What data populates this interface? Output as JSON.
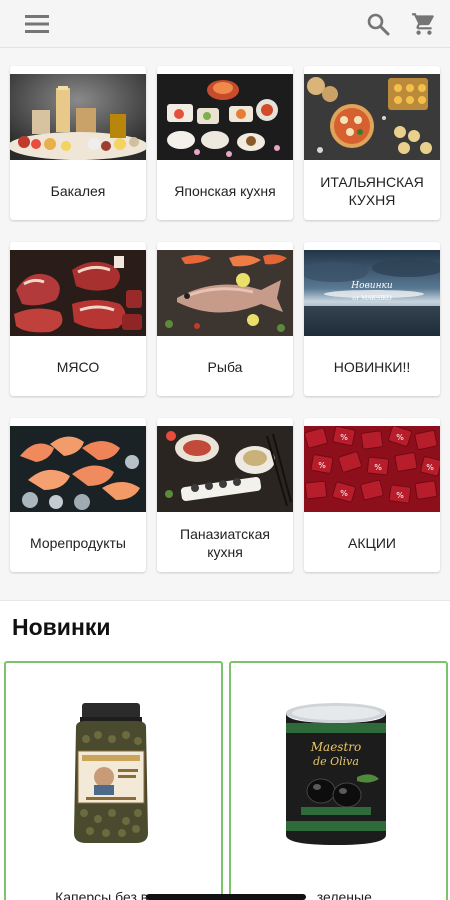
{
  "appbar": {
    "menu_icon": "menu-icon",
    "search_icon": "search-icon",
    "cart_icon": "cart-icon"
  },
  "categories": [
    {
      "label": "Бакалея",
      "image": "groceries-photo"
    },
    {
      "label": "Японская кухня",
      "image": "japanese-food-photo"
    },
    {
      "label": "ИТАЛЬЯНСКАЯ КУХНЯ",
      "image": "italian-food-photo"
    },
    {
      "label": "МЯСО",
      "image": "meat-photo"
    },
    {
      "label": "Рыба",
      "image": "fish-photo"
    },
    {
      "label": "НОВИНКИ!!",
      "image": "new-items-photo",
      "image_text": "Новинки от MAKSIKO"
    },
    {
      "label": "Морепродукты",
      "image": "seafood-photo"
    },
    {
      "label": "Паназиатская кухня",
      "image": "panasian-food-photo"
    },
    {
      "label": "АКЦИИ",
      "image": "sale-photo"
    }
  ],
  "new_section": {
    "title": "Новинки",
    "products": [
      {
        "name": "Каперсы без вет...",
        "image": "capers-jar-photo"
      },
      {
        "name": "...зеленые",
        "image": "olives-can-photo",
        "brand_text": "Maestro de Oliva"
      }
    ]
  },
  "colors": {
    "accent_border": "#7cc36e",
    "appbar_bg": "#f5f5f5",
    "icon": "#757575"
  }
}
